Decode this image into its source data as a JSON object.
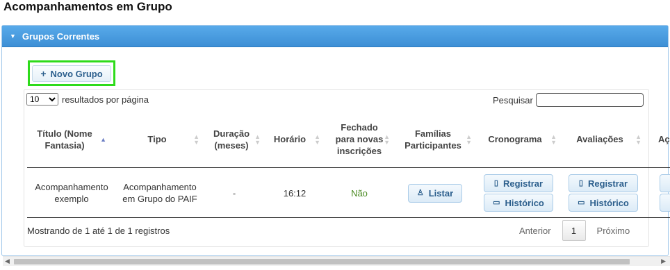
{
  "page": {
    "title": "Acompanhamentos em Grupo"
  },
  "panel": {
    "title": "Grupos Correntes"
  },
  "new_group": {
    "label": "Novo Grupo"
  },
  "table": {
    "length_value": "10",
    "length_suffix": "resultados por página",
    "search_label": "Pesquisar",
    "search_value": "",
    "columns": [
      {
        "label": "Título (Nome Fantasia)"
      },
      {
        "label": "Tipo"
      },
      {
        "label": "Duração (meses)"
      },
      {
        "label": "Horário"
      },
      {
        "label": "Fechado para novas inscrições"
      },
      {
        "label": "Famílias Participantes"
      },
      {
        "label": "Cronograma"
      },
      {
        "label": "Avaliações"
      },
      {
        "label": "Açõ"
      }
    ],
    "rows": [
      {
        "titulo": "Acompanhamento exemplo",
        "tipo": "Acompanhamento em Grupo do PAIF",
        "duracao": "-",
        "horario": "16:12",
        "fechado": "Não",
        "familias_btn": "Listar",
        "cronograma_registrar": "Registrar",
        "cronograma_historico": "Histórico",
        "avaliacoes_registrar": "Registrar",
        "avaliacoes_historico": "Histórico"
      }
    ],
    "info": "Mostrando de 1 até 1 de 1 registros",
    "pager": {
      "prev": "Anterior",
      "current": "1",
      "next": "Próximo"
    }
  },
  "icons": {
    "collapse": "caret-down-icon",
    "add": "plus-icon",
    "sort_asc": "sort-asc-icon",
    "sort": "sort-icon",
    "list": "user-icon",
    "register": "clipboard-icon",
    "history": "comment-icon"
  },
  "colors": {
    "header_blue": "#3d8fd5",
    "highlight_green": "#2edb1b",
    "button_text": "#2c5f8d",
    "status_no": "#4a8a22"
  }
}
